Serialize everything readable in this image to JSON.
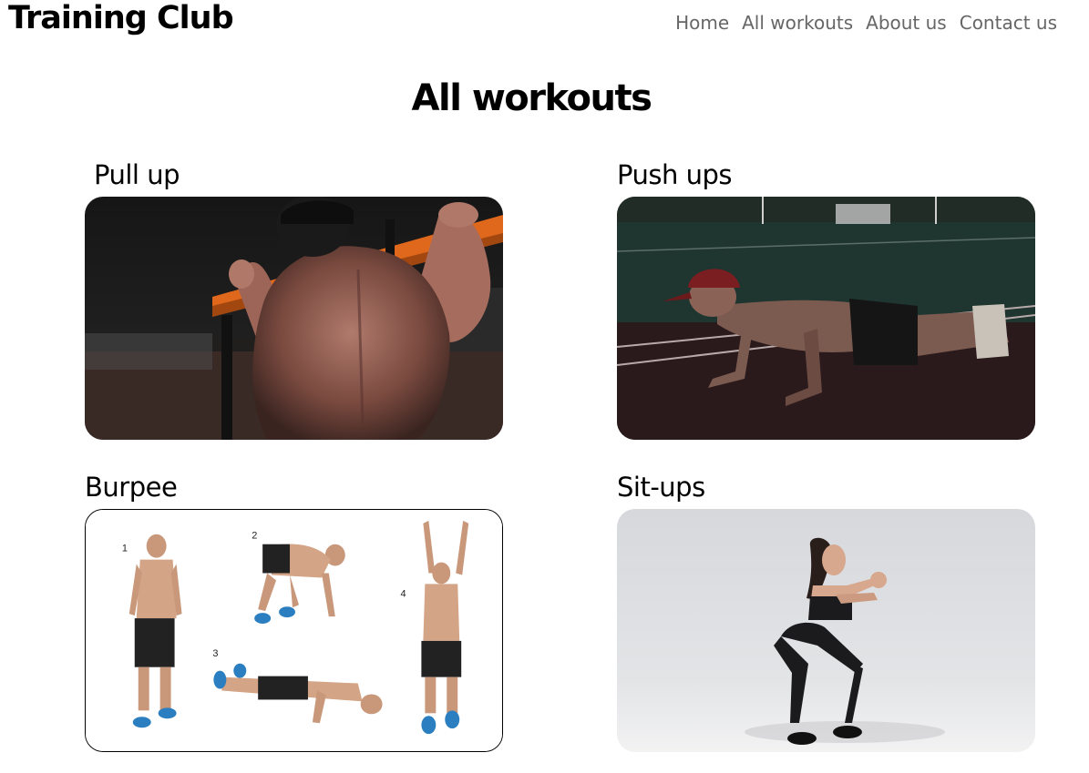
{
  "header": {
    "brand": "Training Club",
    "nav": [
      {
        "label": "Home"
      },
      {
        "label": "All workouts"
      },
      {
        "label": "About us"
      },
      {
        "label": "Contact us"
      }
    ]
  },
  "main": {
    "title": "All workouts",
    "workouts": [
      {
        "title": "Pull up",
        "image_icon": "pull-up-photo"
      },
      {
        "title": "Push ups",
        "image_icon": "push-ups-photo"
      },
      {
        "title": "Burpee",
        "image_icon": "burpee-diagram",
        "step_numbers": [
          "1",
          "2",
          "3",
          "4"
        ]
      },
      {
        "title": "Sit-ups",
        "image_icon": "squat-photo"
      }
    ]
  },
  "colors": {
    "nav_text": "#666666",
    "text": "#000000",
    "background": "#ffffff"
  }
}
